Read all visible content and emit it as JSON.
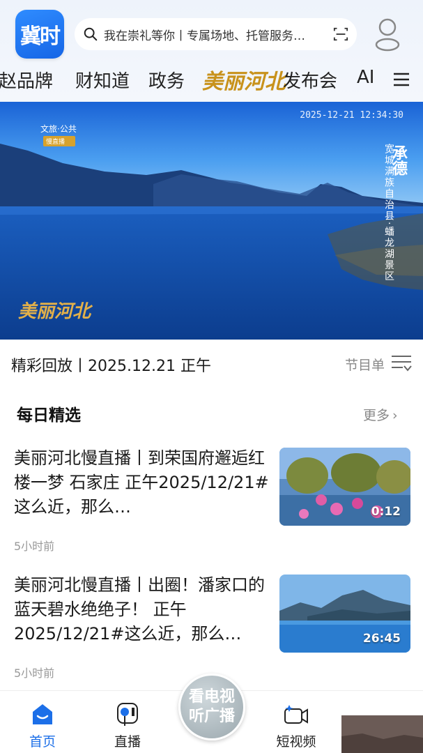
{
  "header": {
    "logo_text": "冀时",
    "search_text": "我在崇礼等你丨专属场地、托管服务…",
    "nav_tabs": [
      "燕赵品牌",
      "财知道",
      "政务",
      "美丽河北",
      "发布会",
      "AI"
    ]
  },
  "hero": {
    "timestamp": "2025-12-21 12:34:30",
    "badge_main": "文旅·公共",
    "badge_sub": "慢直播",
    "location_title": "承德",
    "location_detail": "宽城满族自治县·蟠龙湖景区",
    "brand": "美丽河北"
  },
  "replay": {
    "label": "精彩回放丨2025.12.21  正午",
    "program_label": "节目单"
  },
  "daily": {
    "title": "每日精选",
    "more": "更多",
    "items": [
      {
        "title": "美丽河北慢直播丨到荣国府邂逅红楼一梦  石家庄  正午2025/12/21#这么近，那么…",
        "time": "5小时前",
        "duration": "0:12"
      },
      {
        "title": "美丽河北慢直播丨出圈！潘家口的蓝天碧水绝绝子！  正午2025/12/21#这么近，那么…",
        "time": "5小时前",
        "duration": "26:45"
      }
    ]
  },
  "tabbar": {
    "home": "首页",
    "live": "直播",
    "center": "看电视听广播",
    "center_line1": "看电视",
    "center_line2": "听广播",
    "short_video": "短视频"
  },
  "colors": {
    "accent": "#1c6fe8",
    "brand_gold": "#c8921c",
    "logo_blue": "#1565e6"
  }
}
